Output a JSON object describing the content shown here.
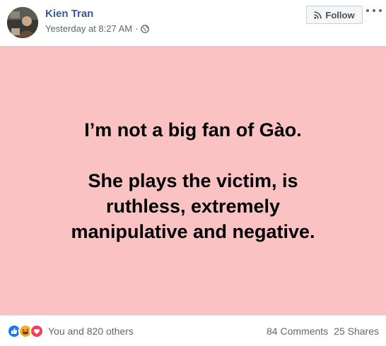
{
  "post": {
    "author": "Kien Tran",
    "timestamp": "Yesterday at 8:27 AM",
    "separator": "·",
    "privacy_icon": "globe-icon",
    "follow_label": "Follow",
    "follow_icon": "rss-icon",
    "more_icon": "more-options-icon"
  },
  "content": {
    "background_color": "#fbc2c4",
    "line1": "I’m not a big fan of Gào.",
    "line2": "She plays the victim, is",
    "line3": "ruthless, extremely",
    "line4": "manipulative and negative."
  },
  "footer": {
    "reaction_icons": [
      "like-icon",
      "haha-icon",
      "love-icon"
    ],
    "reactions_text": "You and 820 others",
    "comments": "84 Comments",
    "shares": "25 Shares"
  },
  "colors": {
    "author_link": "#385898",
    "like": "#1877f2",
    "haha": "#f7b125",
    "love": "#f33e58"
  }
}
